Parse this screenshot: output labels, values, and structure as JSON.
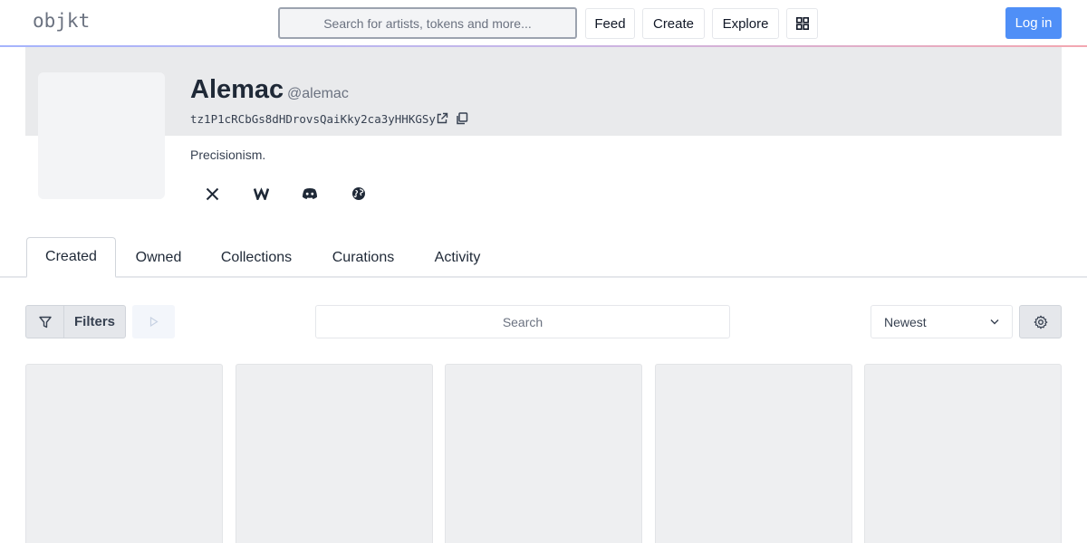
{
  "header": {
    "logo": "objkt",
    "search_placeholder": "Search for artists, tokens and more...",
    "nav": {
      "feed": "Feed",
      "create": "Create",
      "explore": "Explore"
    },
    "login": "Log in"
  },
  "profile": {
    "name": "Alemac",
    "handle": "@alemac",
    "address": "tz1P1cRCbGs8dHDrovsQaiKky2ca3yHHKGSy",
    "bio": "Precisionism.",
    "social_icons": [
      "x-twitter-icon",
      "wordpress-icon",
      "discord-icon",
      "globe-icon"
    ]
  },
  "tabs": [
    {
      "label": "Created",
      "active": true
    },
    {
      "label": "Owned"
    },
    {
      "label": "Collections"
    },
    {
      "label": "Curations"
    },
    {
      "label": "Activity"
    }
  ],
  "toolbar": {
    "filters_label": "Filters",
    "search_placeholder": "Search",
    "sort_value": "Newest"
  },
  "colors": {
    "accent": "#4f8ff7",
    "banner": "#e9eaec",
    "card_placeholder": "#eeeff1"
  }
}
